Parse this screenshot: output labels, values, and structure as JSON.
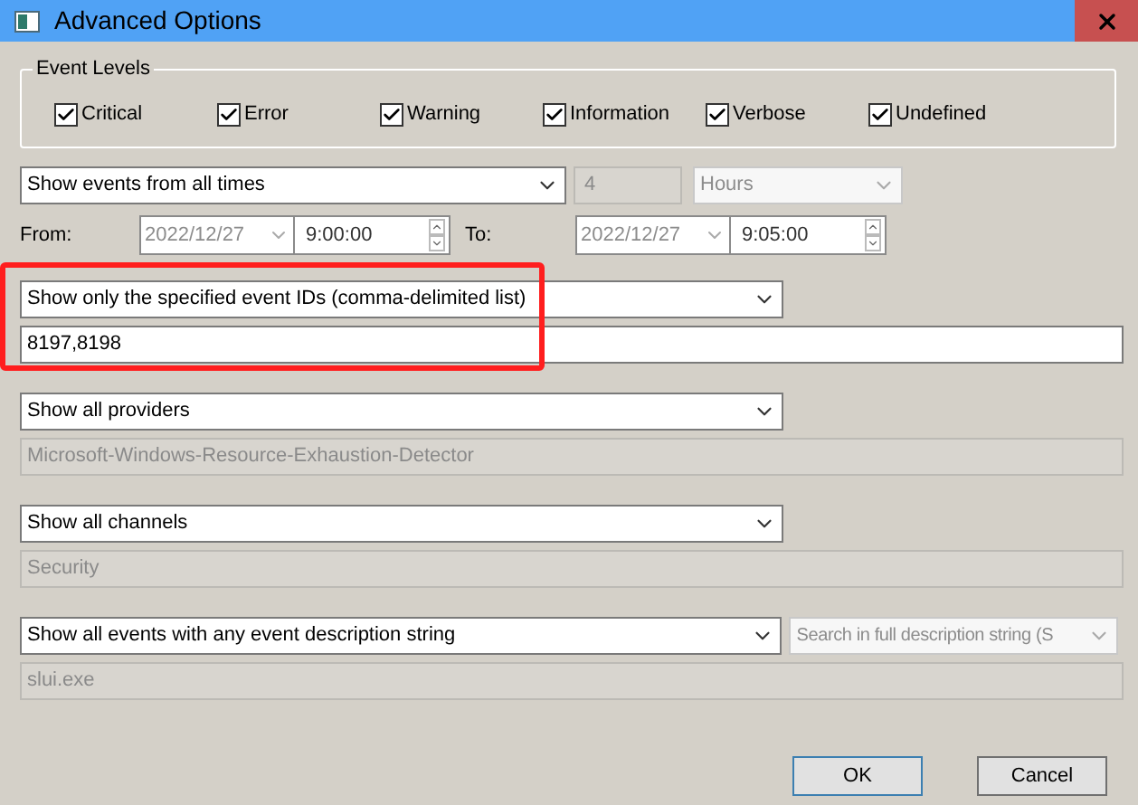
{
  "window": {
    "title": "Advanced Options"
  },
  "event_levels": {
    "title": "Event Levels",
    "items": [
      {
        "label": "Critical",
        "checked": true
      },
      {
        "label": "Error",
        "checked": true
      },
      {
        "label": "Warning",
        "checked": true
      },
      {
        "label": "Information",
        "checked": true
      },
      {
        "label": "Verbose",
        "checked": true
      },
      {
        "label": "Undefined",
        "checked": true
      }
    ]
  },
  "time_filter": {
    "range": "Show events from all times",
    "count": {
      "value": "4",
      "disabled": true
    },
    "unit": {
      "value": "Hours",
      "disabled": true
    },
    "from": {
      "label": "From:",
      "date": "2022/12/27",
      "time": "9:00:00"
    },
    "to": {
      "label": "To:",
      "date": "2022/12/27",
      "time": "9:05:00"
    }
  },
  "sections": [
    {
      "filter": "Show only the specified event IDs (comma-delimited list)",
      "highlighted": true,
      "field": {
        "value": "8197,8198",
        "disabled": false
      }
    },
    {
      "filter": "Show all providers",
      "highlighted": false,
      "field": {
        "value": "Microsoft-Windows-Resource-Exhaustion-Detector",
        "disabled": true
      }
    },
    {
      "filter": "Show all channels",
      "highlighted": false,
      "field": {
        "value": "Security",
        "disabled": true
      }
    },
    {
      "filter": "Show all events with any event description string",
      "highlighted": false,
      "mode": {
        "value": "Search in full description string (S",
        "disabled": true
      },
      "field": {
        "value": "slui.exe",
        "disabled": true
      }
    }
  ],
  "buttons": [
    {
      "label": "OK",
      "default": true
    },
    {
      "label": "Cancel",
      "default": false
    }
  ]
}
